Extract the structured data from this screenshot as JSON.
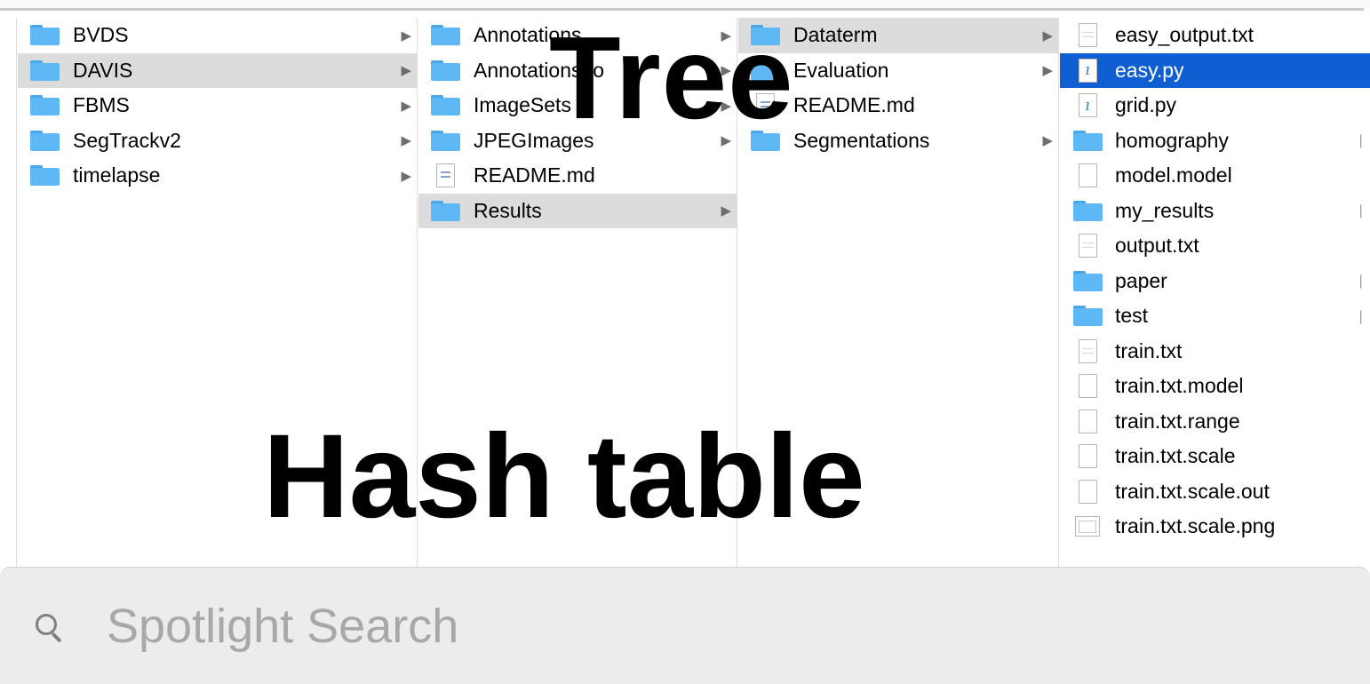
{
  "columns": [
    {
      "items": [
        {
          "label": "BVDS",
          "icon": "folder-icon",
          "arrow": true,
          "state": ""
        },
        {
          "label": "DAVIS",
          "icon": "folder-icon",
          "arrow": true,
          "state": "selected"
        },
        {
          "label": "FBMS",
          "icon": "folder-icon",
          "arrow": true,
          "state": ""
        },
        {
          "label": "SegTrackv2",
          "icon": "folder-icon",
          "arrow": true,
          "state": ""
        },
        {
          "label": "timelapse",
          "icon": "folder-icon",
          "arrow": true,
          "state": ""
        }
      ]
    },
    {
      "items": [
        {
          "label": "Annotations",
          "icon": "folder-icon",
          "arrow": true,
          "state": ""
        },
        {
          "label": "Annotations_o",
          "icon": "folder-icon",
          "arrow": true,
          "state": ""
        },
        {
          "label": "ImageSets",
          "icon": "folder-icon",
          "arrow": true,
          "state": ""
        },
        {
          "label": "JPEGImages",
          "icon": "folder-icon",
          "arrow": true,
          "state": ""
        },
        {
          "label": "README.md",
          "icon": "markdown-file-icon",
          "arrow": false,
          "state": ""
        },
        {
          "label": "Results",
          "icon": "folder-icon",
          "arrow": true,
          "state": "selected"
        }
      ]
    },
    {
      "items": [
        {
          "label": "Dataterm",
          "icon": "folder-icon",
          "arrow": true,
          "state": "selected"
        },
        {
          "label": "Evaluation",
          "icon": "folder-icon",
          "arrow": true,
          "state": ""
        },
        {
          "label": "README.md",
          "icon": "markdown-file-icon",
          "arrow": false,
          "state": ""
        },
        {
          "label": "Segmentations",
          "icon": "folder-icon",
          "arrow": true,
          "state": ""
        }
      ]
    },
    {
      "items": [
        {
          "label": "easy_output.txt",
          "icon": "text-file-icon",
          "arrow": false,
          "state": ""
        },
        {
          "label": "easy.py",
          "icon": "python-file-icon",
          "arrow": false,
          "state": "active"
        },
        {
          "label": "grid.py",
          "icon": "python-file-icon",
          "arrow": false,
          "state": ""
        },
        {
          "label": "homography",
          "icon": "folder-icon",
          "arrow": true,
          "state": ""
        },
        {
          "label": "model.model",
          "icon": "blank-file-icon",
          "arrow": false,
          "state": ""
        },
        {
          "label": "my_results",
          "icon": "folder-icon",
          "arrow": true,
          "state": ""
        },
        {
          "label": "output.txt",
          "icon": "text-file-icon",
          "arrow": false,
          "state": ""
        },
        {
          "label": "paper",
          "icon": "folder-icon",
          "arrow": true,
          "state": ""
        },
        {
          "label": "test",
          "icon": "folder-icon",
          "arrow": true,
          "state": ""
        },
        {
          "label": "train.txt",
          "icon": "text-file-icon",
          "arrow": false,
          "state": ""
        },
        {
          "label": "train.txt.model",
          "icon": "blank-file-icon",
          "arrow": false,
          "state": ""
        },
        {
          "label": "train.txt.range",
          "icon": "blank-file-icon",
          "arrow": false,
          "state": ""
        },
        {
          "label": "train.txt.scale",
          "icon": "blank-file-icon",
          "arrow": false,
          "state": ""
        },
        {
          "label": "train.txt.scale.out",
          "icon": "blank-file-icon",
          "arrow": false,
          "state": ""
        },
        {
          "label": "train.txt.scale.png",
          "icon": "image-file-icon",
          "arrow": false,
          "state": ""
        }
      ]
    }
  ],
  "overlay": {
    "top_text": "Tree",
    "bottom_text": "Hash table"
  },
  "search": {
    "placeholder": "Spotlight Search",
    "value": ""
  },
  "colors": {
    "selection_active": "#0f5fd2",
    "selection_inactive": "#dcdcdc",
    "folder": "#5eb8f5",
    "search_bg": "#ececec"
  }
}
